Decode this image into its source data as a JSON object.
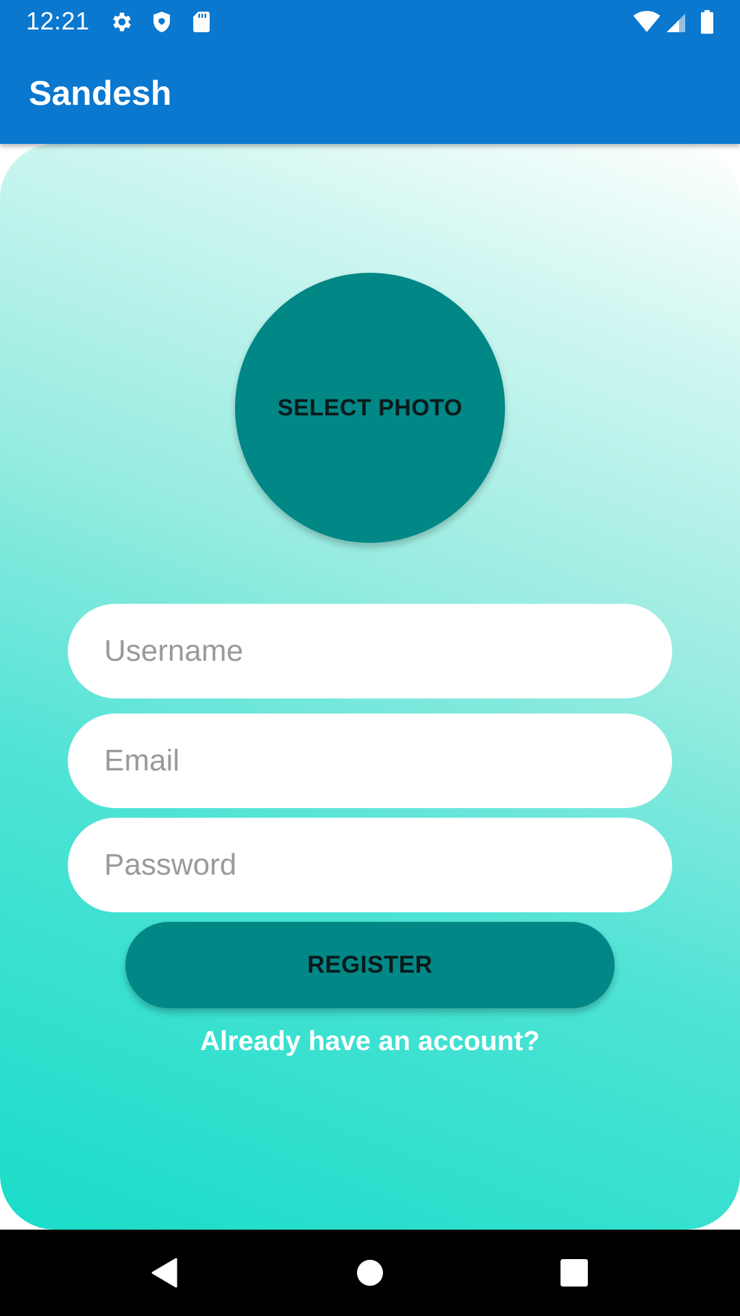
{
  "status_bar": {
    "time": "12:21",
    "icons": [
      "settings-icon",
      "shield-icon",
      "sd-card-icon",
      "wifi-icon",
      "signal-icon",
      "battery-icon"
    ]
  },
  "app_bar": {
    "title": "Sandesh"
  },
  "form": {
    "photo_button_label": "SELECT PHOTO",
    "username_placeholder": "Username",
    "email_placeholder": "Email",
    "password_placeholder": "Password",
    "register_label": "REGISTER",
    "login_link": "Already have an account?"
  },
  "nav_bar": {
    "icons": [
      "back-icon",
      "home-icon",
      "recents-icon"
    ]
  },
  "colors": {
    "app_bar": "#0a78cf",
    "accent": "#018786",
    "gradient_top": "#ffffff",
    "gradient_bottom": "#1adcc9"
  }
}
